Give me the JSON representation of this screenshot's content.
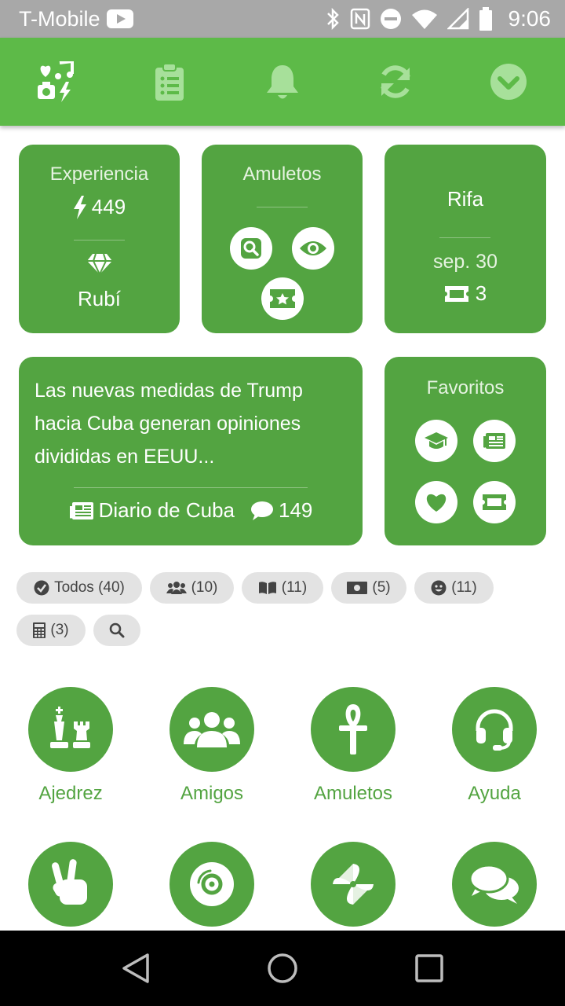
{
  "status_bar": {
    "carrier": "T-Mobile",
    "time": "9:06"
  },
  "app_bar": {
    "tabs": [
      {
        "icon": "services-icon"
      },
      {
        "icon": "clipboard-list-icon"
      },
      {
        "icon": "bell-icon"
      },
      {
        "icon": "sync-icon"
      },
      {
        "icon": "check-circle-icon"
      }
    ]
  },
  "experience_card": {
    "title": "Experiencia",
    "points": "449",
    "level": "Rubí"
  },
  "amulets_card": {
    "title": "Amuletos",
    "icons": [
      "search-icon",
      "eye-icon",
      "ticket-star-icon"
    ]
  },
  "raffle_card": {
    "title": "Rifa",
    "date": "sep. 30",
    "tickets": "3"
  },
  "news_card": {
    "headline": "Las nuevas medidas de Trump hacia Cuba generan opiniones divididas en EEUU...",
    "source": "Diario de Cuba",
    "comments": "149"
  },
  "favorites_card": {
    "title": "Favoritos",
    "icons": [
      "graduation-cap-icon",
      "newspaper-icon",
      "heart-icon",
      "ticket-icon"
    ]
  },
  "filters": [
    {
      "label": "Todos (40)",
      "icon": "check-circle-icon"
    },
    {
      "label": "(10)",
      "icon": "users-icon"
    },
    {
      "label": "(11)",
      "icon": "book-icon"
    },
    {
      "label": "(5)",
      "icon": "money-icon"
    },
    {
      "label": "(11)",
      "icon": "smile-icon"
    },
    {
      "label": "(3)",
      "icon": "calculator-icon"
    },
    {
      "label": "",
      "icon": "search-icon"
    }
  ],
  "apps": [
    {
      "label": "Ajedrez",
      "icon": "chess-icon"
    },
    {
      "label": "Amigos",
      "icon": "users-icon"
    },
    {
      "label": "Amuletos",
      "icon": "ankh-icon"
    },
    {
      "label": "Ayuda",
      "icon": "headset-icon"
    },
    {
      "label": "",
      "icon": "peace-hand-icon"
    },
    {
      "label": "",
      "icon": "record-icon"
    },
    {
      "label": "",
      "icon": "pinwheel-icon"
    },
    {
      "label": "",
      "icon": "comments-icon"
    }
  ],
  "colors": {
    "primary": "#5dba48",
    "card": "#53a441",
    "chip": "#e3e3e3",
    "status_bar": "#a8a8a8"
  }
}
